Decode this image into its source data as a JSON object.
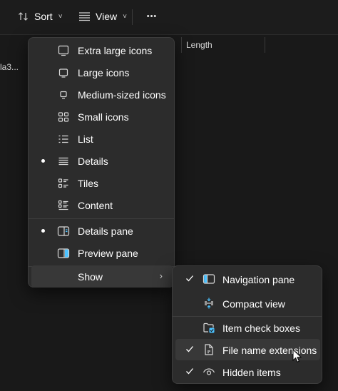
{
  "toolbar": {
    "sort_label": "Sort",
    "view_label": "View",
    "more_label": "•••",
    "chevron": "˅"
  },
  "file_list": {
    "column_length": "Length",
    "row_fragment": "la3..."
  },
  "view_menu": {
    "items": [
      {
        "label": "Extra large icons",
        "icon": "monitor-large-icon",
        "selected": false
      },
      {
        "label": "Large icons",
        "icon": "monitor-icon",
        "selected": false
      },
      {
        "label": "Medium-sized icons",
        "icon": "monitor-small-icon",
        "selected": false
      },
      {
        "label": "Small icons",
        "icon": "small-icons-grid-icon",
        "selected": false
      },
      {
        "label": "List",
        "icon": "list-icon",
        "selected": false
      },
      {
        "label": "Details",
        "icon": "details-icon",
        "selected": true
      },
      {
        "label": "Tiles",
        "icon": "tiles-icon",
        "selected": false
      },
      {
        "label": "Content",
        "icon": "content-icon",
        "selected": false
      },
      {
        "label": "Details pane",
        "icon": "details-pane-icon",
        "selected": true
      },
      {
        "label": "Preview pane",
        "icon": "preview-pane-icon",
        "selected": false
      },
      {
        "label": "Show",
        "icon": "",
        "selected": false
      }
    ],
    "submenu_arrow": "›"
  },
  "show_submenu": {
    "items": [
      {
        "label": "Navigation pane",
        "icon": "navigation-pane-icon",
        "checked": true
      },
      {
        "label": "Compact view",
        "icon": "compact-view-icon",
        "checked": false
      },
      {
        "label": "Item check boxes",
        "icon": "item-check-boxes-icon",
        "checked": false
      },
      {
        "label": "File name extensions",
        "icon": "file-extension-icon",
        "checked": true
      },
      {
        "label": "Hidden items",
        "icon": "eye-icon",
        "checked": true
      }
    ]
  },
  "colors": {
    "accent": "#4cc2ff",
    "menu_bg": "#2c2c2c",
    "hover_bg": "#383838",
    "window_bg": "#191919"
  }
}
